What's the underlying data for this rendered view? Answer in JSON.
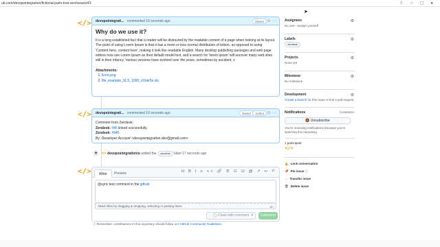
{
  "browser": {
    "url": "ub.com/devopsintegration/fictional-palm-tree-zen/issues/43",
    "icons": "⇧ ☆ ▢ ●"
  },
  "comment1": {
    "author": "devopsintegrati...",
    "meta": "commented 19 seconds ago",
    "badge_owner": "Owner",
    "heading": "Why do we use it?",
    "paragraph": "It is a long established fact that a reader will be distracted by the readable content of a page when looking at its layout. The point of using Lorem Ipsum is that it has a more-or-less normal distribution of letters, as opposed to using 'Content here, content here', making it look like readable English. Many desktop publishing packages and web page editors now use Lorem Ipsum as their default model text, and a search for 'lorem ipsum' will uncover many web sites still in their infancy. Various versions have evolved over the years, sometimes by accident, s",
    "attachments_label": "Attachments:",
    "attachments": [
      "Error.png",
      "file_example_XLS_1000_nVxkr5o.xls"
    ]
  },
  "comment2": {
    "author": "devopsintegrati...",
    "meta": "commented 19 seconds ago",
    "badge_owner": "Owner",
    "badge_author": "Author",
    "line1": "Comment from Zendesk:",
    "line2_label": "Zendesk:",
    "line2_link": "945",
    "line2_rest": "linked successfully.",
    "line3_label": "Zendesk:",
    "line3_link": "#945",
    "line4_label": "By:",
    "line4_rest": "Developer Account <devopsintegration.dev@gmail.com>"
  },
  "event": {
    "actor": "devopsintegrationio",
    "action": "added the",
    "label": "zendesk",
    "suffix": "label 17 seconds ago"
  },
  "editor": {
    "tab_write": "Write",
    "tab_preview": "Preview",
    "toolbar": "H B I ≡ <> 🔗 ☰ ☷ ☑ @ ↗ ↩ ↶",
    "text_before": "@sync test comment in the ",
    "text_link": "github",
    "attach_hint": "Attach files by dragging & dropping, selecting or pasting them.",
    "md_badge": "M↓",
    "close_button": "Close with comment",
    "comment_button": "Comment"
  },
  "footer": {
    "tip_before": "Remember, contributions to this repository should follow our ",
    "tip_link": "GitHub Community Guidelines",
    "tip_after": "."
  },
  "sidebar": {
    "assignees_title": "Assignees",
    "assignees_value": "No one—assign yourself",
    "labels_title": "Labels",
    "labels_value": "zendesk",
    "projects_title": "Projects",
    "projects_value": "None yet",
    "milestone_title": "Milestone",
    "milestone_value": "No milestone",
    "development_title": "Development",
    "development_link": "Create a branch",
    "development_rest": " for this issue or link a pull request.",
    "notifications_title": "Notifications",
    "customize": "Customize",
    "unsubscribe": "Unsubscribe",
    "notif_note": "You're receiving notifications because you're watching this repository.",
    "participants": "1 participant",
    "lock": "Lock conversation",
    "pin": "Pin issue",
    "transfer": "Transfer issue",
    "delete": "Delete issue"
  }
}
